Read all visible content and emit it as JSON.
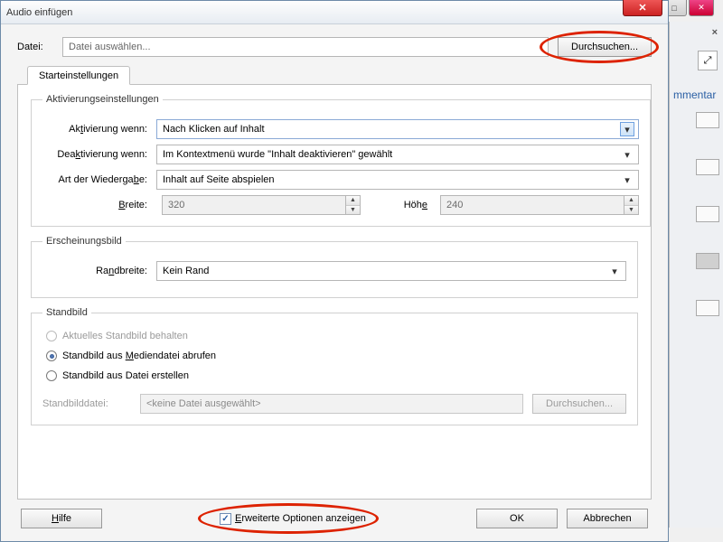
{
  "window": {
    "title": "Audio einfügen"
  },
  "file": {
    "label": "Datei:",
    "placeholder": "Datei auswählen...",
    "browse": "Durchsuchen..."
  },
  "tabs": {
    "start": "Starteinstellungen"
  },
  "activation": {
    "legend": "Aktivierungseinstellungen",
    "activate_label_pre": "Ak",
    "activate_label_u": "t",
    "activate_label_post": "ivierung wenn:",
    "activate_value": "Nach Klicken auf Inhalt",
    "deactivate_label_pre": "Dea",
    "deactivate_label_u": "k",
    "deactivate_label_post": "tivierung wenn:",
    "deactivate_value": "Im Kontextmenü wurde \"Inhalt deaktivieren\" gewählt",
    "playback_label_pre": "Art der Wiederga",
    "playback_label_u": "b",
    "playback_label_post": "e:",
    "playback_value": "Inhalt auf Seite abspielen",
    "width_label_u": "B",
    "width_label_post": "reite:",
    "width_value": "320",
    "height_label_pre": "Höh",
    "height_label_u": "e",
    "height_value": "240"
  },
  "appearance": {
    "legend": "Erscheinungsbild",
    "border_label_pre": "Ra",
    "border_label_u": "n",
    "border_label_post": "dbreite:",
    "border_value": "Kein Rand"
  },
  "still": {
    "legend": "Standbild",
    "keep": "Aktuelles Standbild behalten",
    "from_media_pre": "Standbild aus ",
    "from_media_u": "M",
    "from_media_post": "ediendatei abrufen",
    "from_file": "Standbild aus Datei erstellen",
    "file_label": "Standbilddatei:",
    "file_value": "<keine Datei ausgewählt>",
    "browse": "Durchsuchen..."
  },
  "footer": {
    "help_u": "H",
    "help_post": "ilfe",
    "adv_u": "E",
    "adv_post": "rweiterte Optionen anzeigen",
    "ok": "OK",
    "cancel": "Abbrechen"
  },
  "side": {
    "mmentar": "mmentar"
  }
}
